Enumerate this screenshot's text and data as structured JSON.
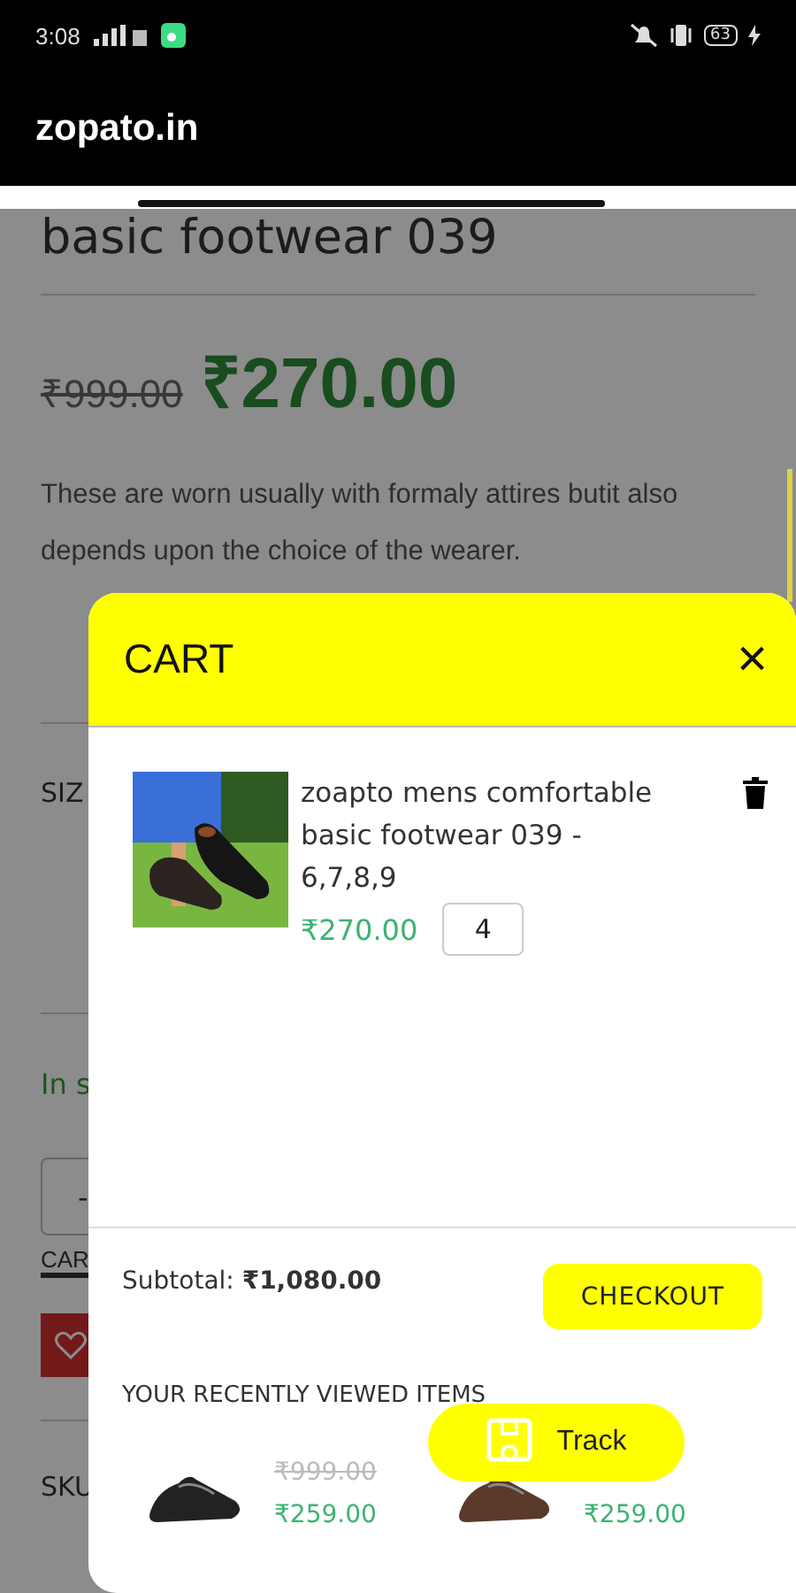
{
  "status_bar": {
    "time": "3:08",
    "battery": "63"
  },
  "app_bar": {
    "title": "zopato.in"
  },
  "product": {
    "title": "basic footwear 039",
    "old_price": "₹999.00",
    "price": "₹270.00",
    "description": "These are worn usually with formaly attires butit also depends upon the choice of the wearer.",
    "size_label": "SIZ",
    "stock": "In s",
    "quantity": "-",
    "cart_label": "CAR",
    "sku_label": "SKU"
  },
  "cart": {
    "title": "CART",
    "close": "×",
    "items": [
      {
        "name": "zoapto mens comfortable basic footwear 039 - 6,7,8,9",
        "price": "₹270.00",
        "quantity": "4"
      }
    ],
    "subtotal": "Subtotal: **₹1,080.00**",
    "checkout": "CHECKOUT",
    "recent_title": "YOUR RECENTLY VIEWED ITEMS",
    "recent": [
      {
        "old_price": "₹999.00",
        "price": "₹259.00",
        "color": "#222222"
      },
      {
        "price": "₹259.00",
        "color": "#5a3a2a"
      }
    ]
  },
  "track_button": "Track"
}
